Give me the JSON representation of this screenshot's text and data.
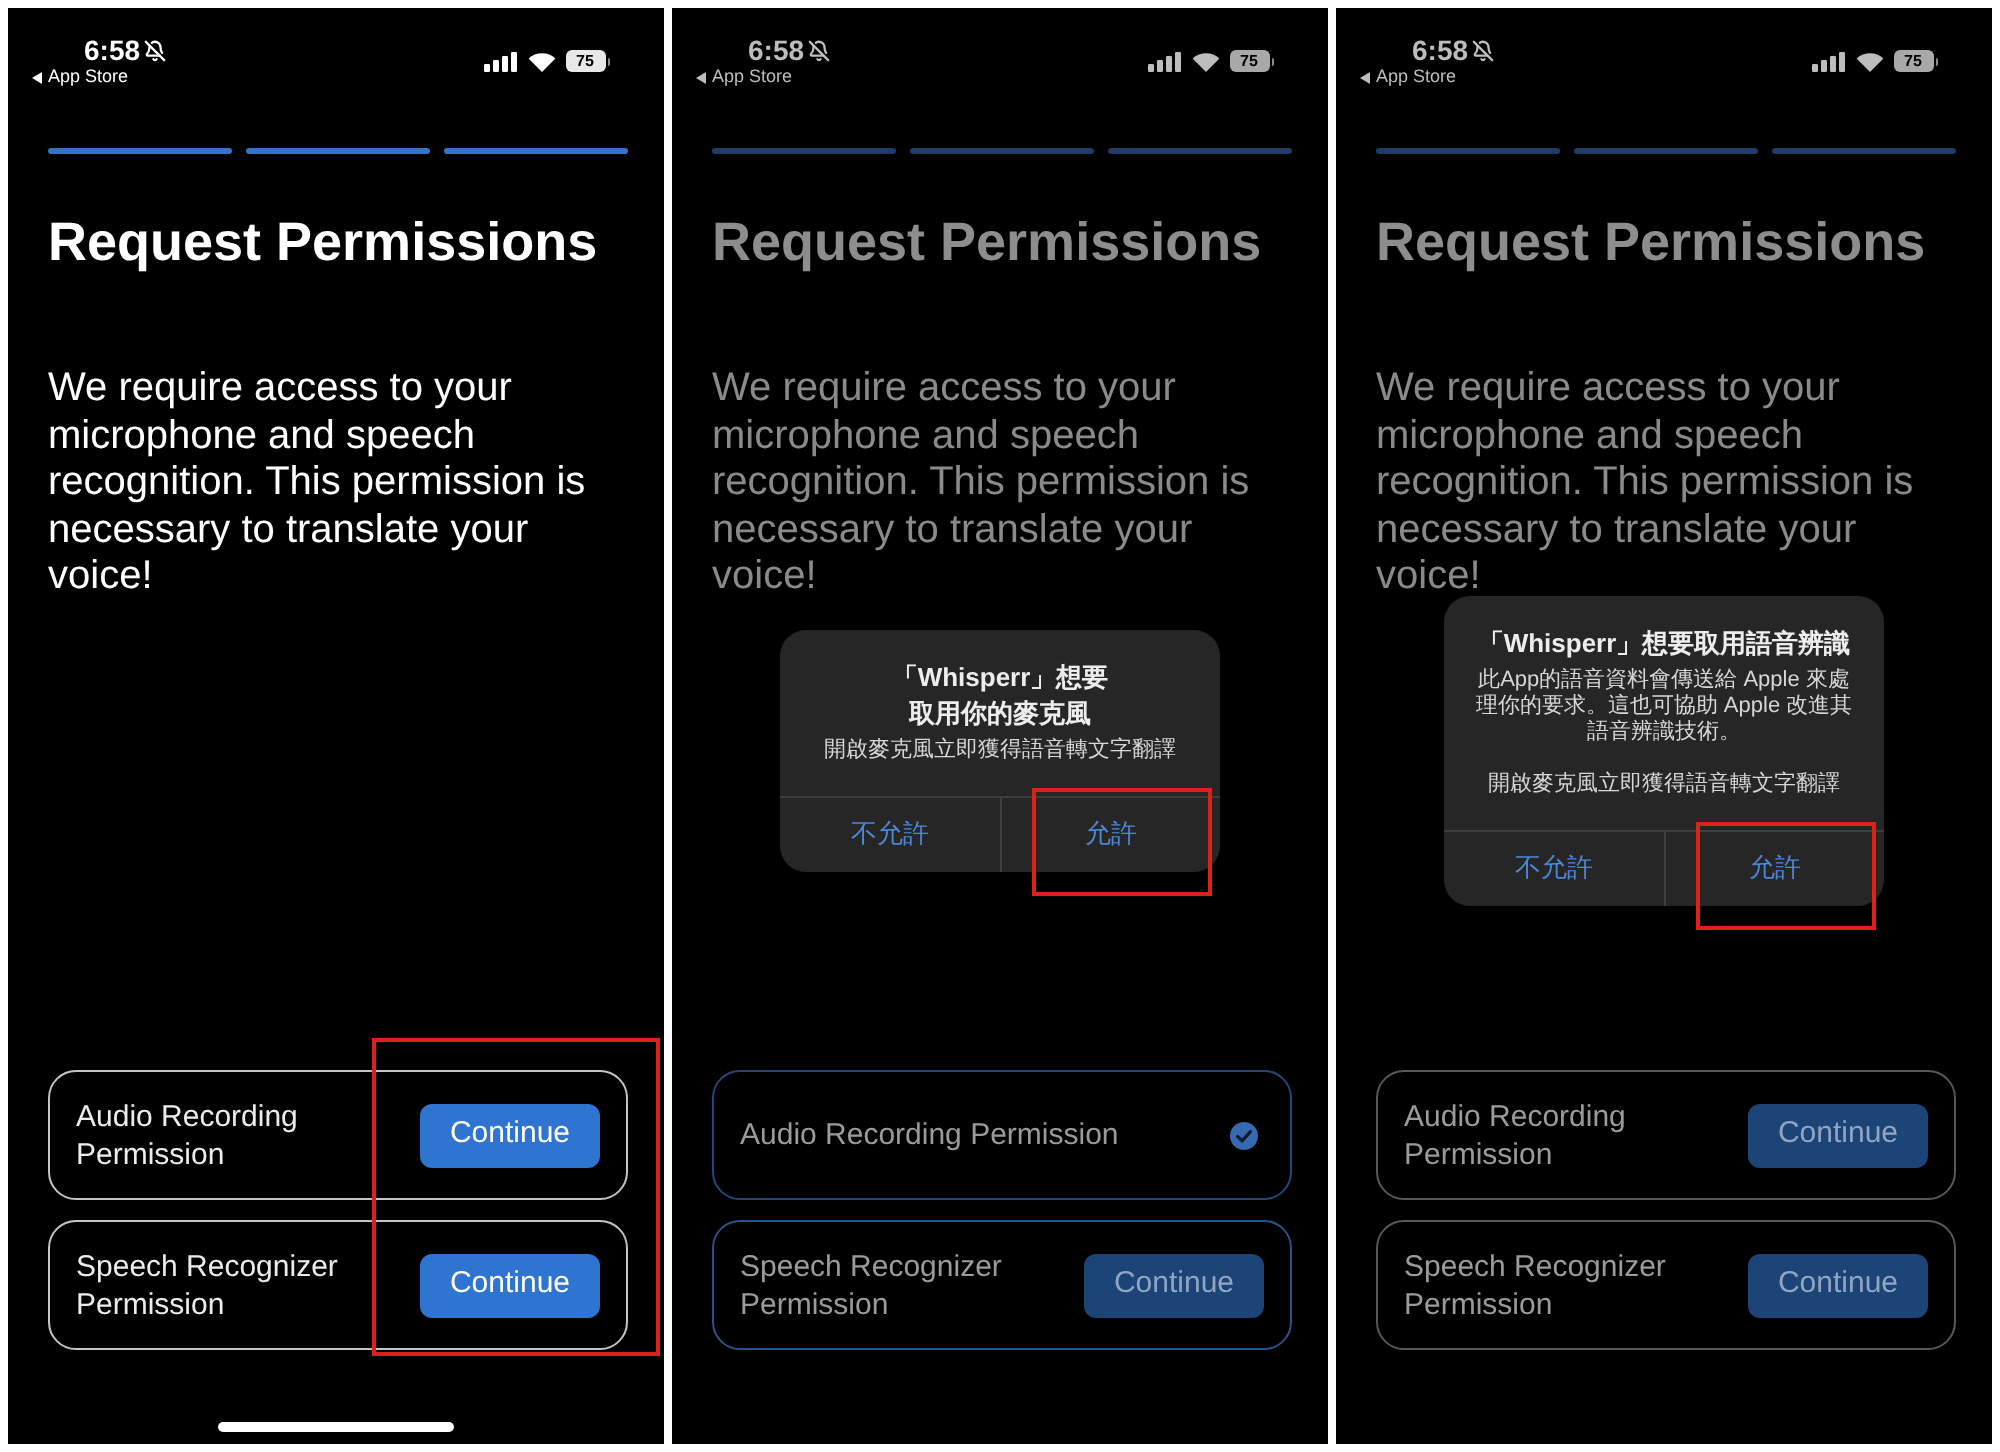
{
  "screens": [
    {
      "status_bar": {
        "time": "6:58",
        "back_label": "App Store",
        "battery": "75"
      },
      "steps": [
        {
          "completed": true
        },
        {
          "completed": true
        },
        {
          "completed": true
        }
      ],
      "title": "Request Permissions",
      "message": "We require access to your microphone and speech recognition. This permission is necessary to translate your voice!",
      "permissions": [
        {
          "label": "Audio Recording Permission",
          "granted": false,
          "focused": false,
          "button": "Continue"
        },
        {
          "label": "Speech Recognizer Permission",
          "granted": false,
          "focused": false,
          "button": "Continue"
        }
      ],
      "continue_buttons_highlighted": true,
      "home_indicator": true
    },
    {
      "status_bar": {
        "time": "6:58",
        "back_label": "App Store",
        "battery": "75"
      },
      "steps": [
        {
          "completed": true
        },
        {
          "completed": true
        },
        {
          "completed": true
        }
      ],
      "title": "Request Permissions",
      "message": "We require access to your microphone and speech recognition. This permission is necessary to translate your voice!",
      "permissions": [
        {
          "label": "Audio Recording Permission",
          "granted": true,
          "focused": false
        },
        {
          "label": "Speech Recognizer Permission",
          "granted": false,
          "focused": true,
          "button": "Continue"
        }
      ],
      "continue_buttons_highlighted": false,
      "home_indicator": false,
      "dialog": {
        "title_lines": [
          "「Whisperr」想要",
          "取用你的麥克風"
        ],
        "paragraphs": [
          "開啟麥克風立即獲得語音轉文字翻譯"
        ],
        "buttons": [
          {
            "label": "不允許",
            "highlighted": false
          },
          {
            "label": "允許",
            "highlighted": true
          }
        ]
      }
    },
    {
      "status_bar": {
        "time": "6:58",
        "back_label": "App Store",
        "battery": "75"
      },
      "steps": [
        {
          "completed": true
        },
        {
          "completed": true
        },
        {
          "completed": true
        }
      ],
      "title": "Request Permissions",
      "message": "We require access to your microphone and speech recognition. This permission is necessary to translate your voice!",
      "permissions": [
        {
          "label": "Audio Recording Permission",
          "granted": false,
          "focused": false,
          "button": "Continue"
        },
        {
          "label": "Speech Recognizer Permission",
          "granted": false,
          "focused": false,
          "button": "Continue"
        }
      ],
      "continue_buttons_highlighted": false,
      "home_indicator": false,
      "dialog": {
        "title_lines": [
          "「Whisperr」想要取用語音辨識"
        ],
        "paragraphs": [
          "此App的語音資料會傳送給 Apple 來處理你的要求。這也可協助 Apple 改進其語音辨識技術。",
          "開啟麥克風立即獲得語音轉文字翻譯"
        ],
        "buttons": [
          {
            "label": "不允許",
            "highlighted": false
          },
          {
            "label": "允許",
            "highlighted": true
          }
        ]
      }
    }
  ]
}
